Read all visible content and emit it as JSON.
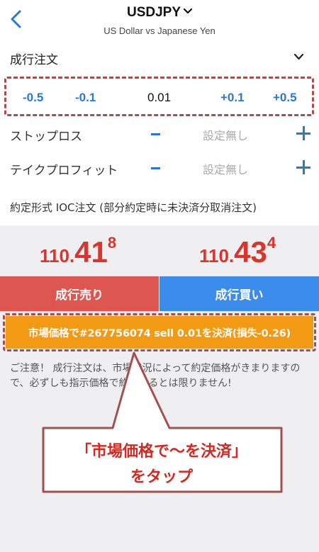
{
  "header": {
    "title": "USDJPY",
    "subtitle": "US Dollar vs Japanese Yen",
    "back_icon": "chevron-left-icon",
    "dropdown_icon": "chevron-down-icon"
  },
  "order": {
    "type_label": "成行注文",
    "lot": {
      "minus_large": "-0.5",
      "minus_small": "-0.1",
      "value": "0.01",
      "plus_small": "+0.1",
      "plus_large": "+0.5"
    },
    "stop_loss": {
      "label": "ストップロス",
      "value": "設定無し"
    },
    "take_profit": {
      "label": "テイクプロフィット",
      "value": "設定無し"
    },
    "execution_type": "約定形式 IOC注文 (部分約定時に未決済分取消注文)"
  },
  "prices": {
    "sell": {
      "base": "110.",
      "pips": "41",
      "fraction": "8"
    },
    "buy": {
      "base": "110.",
      "pips": "43",
      "fraction": "4"
    }
  },
  "buttons": {
    "sell": "成行売り",
    "buy": "成行買い",
    "settle": "市場価格で#267756074 sell 0.01を決済(損失-0.26)"
  },
  "notice": "ご注意！ 成行注文は、市場状況によって約定価格がきまりますので、必ずしも指示価格で約定するとは限りません!",
  "callout": {
    "line1": "「市場価格で〜を決済」",
    "line2": "をタップ"
  },
  "colors": {
    "accent_blue": "#2a78d1",
    "sell_red": "#de5650",
    "buy_blue": "#3c8cec",
    "settle_orange": "#f29a14",
    "price_red": "#d8352e",
    "annotation_red": "#a3504f"
  }
}
